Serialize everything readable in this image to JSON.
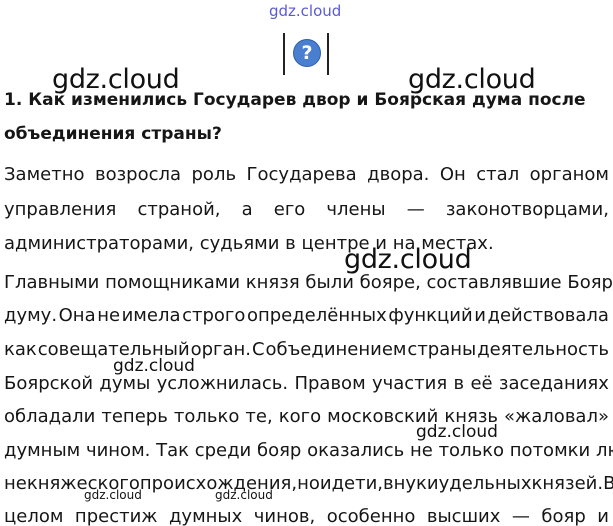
{
  "watermarks": {
    "top": "gdz.cloud",
    "left_top": "gdz.cloud",
    "right_top": "gdz.cloud",
    "center": "gdz.cloud",
    "left_mid": "gdz.cloud",
    "right_mid": "gdz.cloud",
    "bottom_left": "gdz.cloud",
    "bottom_center": "gdz.cloud"
  },
  "icon": {
    "name": "question-mark-icon",
    "glyph": "?"
  },
  "question": {
    "line1": "1. Как изменились Государев двор и Боярская дума после",
    "line2": "объединения страны?"
  },
  "paragraph1": {
    "line1": [
      "Заметно",
      "возросла",
      "роль",
      "Государева",
      "двора.",
      "Он",
      "стал",
      "органом"
    ],
    "line2": [
      "управления",
      "страной,",
      "а",
      "его",
      "члены",
      "—",
      "законотворцами,"
    ],
    "line3": "администраторами, судьями в центре и на местах."
  },
  "paragraph2": {
    "line1": "Главными помощниками князя были бояре, составлявшие Боярскую",
    "line2": [
      "думу.",
      "Она",
      "не",
      "имела",
      "строго",
      "определённых",
      "функций",
      "и",
      "действовала"
    ],
    "line3": [
      "как",
      "совещательный",
      "орган.",
      "С",
      "объединением",
      "страны",
      "деятельность"
    ],
    "line4": [
      "Боярской",
      "думы",
      "усложнилась.",
      "Правом",
      "участия",
      "в",
      "её",
      "заседаниях"
    ],
    "line5": [
      "обладали",
      "теперь",
      "только",
      "те,",
      "кого",
      "московский",
      "князь",
      "«жаловал»"
    ],
    "line6": "думным чином. Так среди бояр оказались не только потомки людей",
    "line7": [
      "некняжеского",
      "происхождения,",
      "но",
      "и",
      "дети,",
      "внуки",
      "удельных",
      "князей.",
      "В"
    ],
    "line8": [
      "целом",
      "престиж",
      "думных",
      "чинов,",
      "особенно",
      "высших",
      "—",
      "бояр",
      "и"
    ]
  }
}
